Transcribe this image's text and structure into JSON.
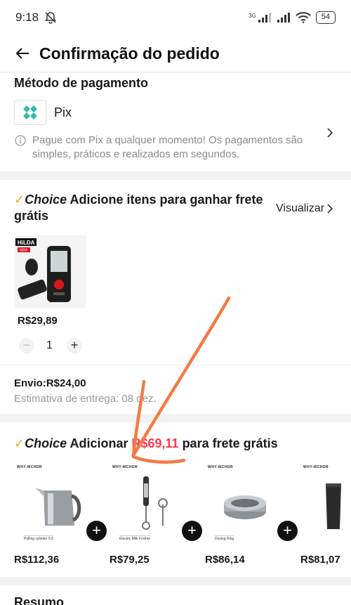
{
  "status_bar": {
    "time": "9:18",
    "network": "3G",
    "battery": "54"
  },
  "header": {
    "title": "Confirmação do pedido"
  },
  "payment": {
    "title": "Método de pagamento",
    "method": "Pix",
    "note": "Pague com Pix a qualquer momento! Os pagamentos são simples, práticos e realizados em segundos."
  },
  "choice_section": {
    "logo": "Choice",
    "title": "Adicione itens para ganhar frete grátis",
    "view_label": "Visualizar",
    "product": {
      "brand": "HiLDA",
      "badge": "50M",
      "price": "R$29,89",
      "quantity": "1",
      "minus": "−",
      "plus": "+"
    },
    "shipping": "Envio:R$24,00",
    "estimate": "Estimativa de entrega: 08 dez."
  },
  "free_shipping": {
    "logo": "Choice",
    "prefix": "Adicionar",
    "amount": "R$69,11",
    "suffix": "para frete grátis",
    "items": [
      {
        "price": "R$112,36",
        "caption": "Pulling cylinder 5.0",
        "brand": "WHY-MCHDR"
      },
      {
        "price": "R$79,25",
        "caption": "Electric Milk Frother",
        "brand": "WHY-MCHDR"
      },
      {
        "price": "R$86,14",
        "caption": "Dosing Ring",
        "brand": "WHY-MCHDR"
      },
      {
        "price": "R$81,07",
        "caption": "",
        "brand": "WHY-MCHDR"
      }
    ],
    "add_symbol": "+"
  },
  "summary": {
    "title": "Resumo"
  },
  "colors": {
    "accent_red": "#fd384f",
    "annotation_orange": "#f47a45",
    "pix_teal": "#32bcad"
  }
}
